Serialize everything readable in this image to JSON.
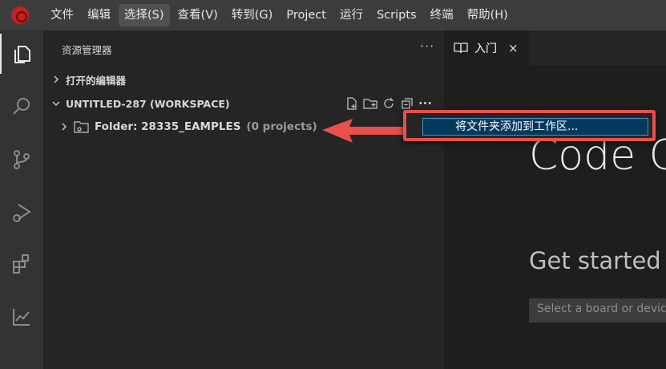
{
  "menu": {
    "items": [
      "文件",
      "编辑",
      "选择(S)",
      "查看(V)",
      "转到(G)",
      "Project",
      "运行",
      "Scripts",
      "终端",
      "帮助(H)"
    ],
    "active_index": 2
  },
  "activity_bar": {
    "icons": [
      "explorer-icon",
      "search-icon",
      "source-control-icon",
      "run-debug-icon",
      "extensions-icon",
      "chart-icon"
    ]
  },
  "sidebar": {
    "header": "资源管理器",
    "open_editors": "打开的编辑器",
    "workspace": "UNTITLED-287 (WORKSPACE)",
    "folder_label": "Folder: 28335_EAMPLES",
    "folder_count": "(0 projects)"
  },
  "tab": {
    "label": "入门",
    "close": "×"
  },
  "editor": {
    "welcome_title": "Code Co",
    "get_started": "Get started",
    "board_placeholder": "Select a board or device"
  },
  "context_menu": {
    "item": "将文件夹添加到工作区..."
  },
  "colors": {
    "accent_red": "#e8504b",
    "menu_selected": "#04395e",
    "app_logo": "#c81e1e"
  }
}
